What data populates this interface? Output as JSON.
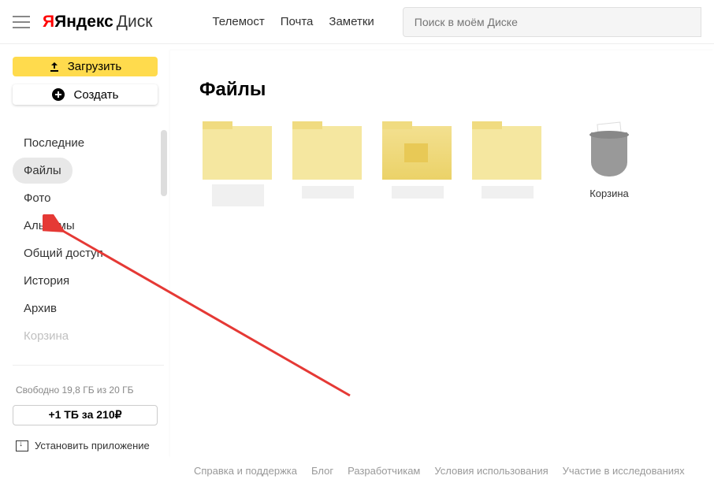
{
  "header": {
    "logo_primary": "Яндекс",
    "logo_secondary": "Диск",
    "links": [
      "Телемост",
      "Почта",
      "Заметки"
    ],
    "search_placeholder": "Поиск в моём Диске"
  },
  "sidebar": {
    "upload_label": "Загрузить",
    "create_label": "Создать",
    "nav": [
      {
        "label": "Последние",
        "active": false
      },
      {
        "label": "Файлы",
        "active": true
      },
      {
        "label": "Фото",
        "active": false
      },
      {
        "label": "Альбомы",
        "active": false
      },
      {
        "label": "Общий доступ",
        "active": false
      },
      {
        "label": "История",
        "active": false
      },
      {
        "label": "Архив",
        "active": false
      },
      {
        "label": "Корзина",
        "active": false,
        "dim": true
      }
    ],
    "storage_text": "Свободно 19,8 ГБ из 20 ГБ",
    "storage_btn": "+1 ТБ за 210₽",
    "install_app": "Установить приложение"
  },
  "main": {
    "title": "Файлы",
    "trash_label": "Корзина"
  },
  "footer": {
    "links": [
      "Справка и поддержка",
      "Блог",
      "Разработчикам",
      "Условия использования",
      "Участие в исследованиях"
    ]
  }
}
